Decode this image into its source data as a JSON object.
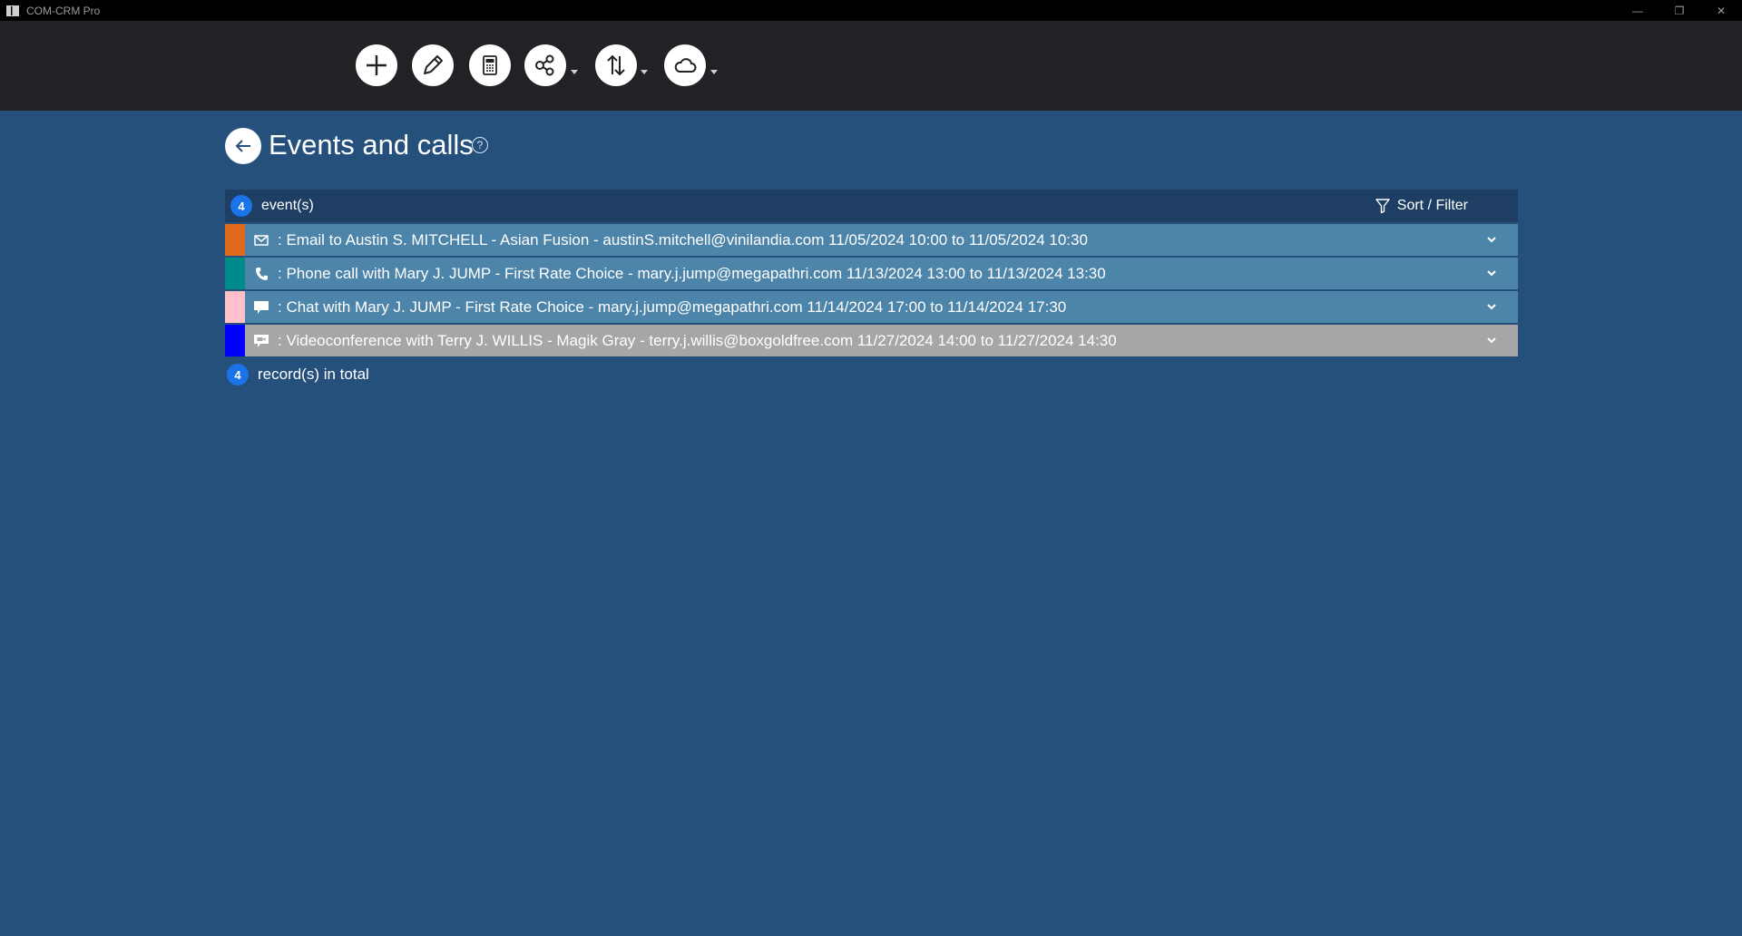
{
  "window": {
    "title": "COM-CRM Pro",
    "controls": {
      "minimize": "—",
      "restore": "❐",
      "close": "✕"
    }
  },
  "toolbar": {
    "buttons": [
      {
        "name": "add-icon"
      },
      {
        "name": "pencil-icon"
      },
      {
        "name": "calculator-icon"
      },
      {
        "name": "share-icon",
        "dropdown": true
      },
      {
        "name": "sort-arrows-icon",
        "dropdown": true
      },
      {
        "name": "cloud-icon",
        "dropdown": true
      }
    ]
  },
  "page": {
    "title": "Events and calls",
    "help_glyph": "?"
  },
  "list": {
    "count": "4",
    "count_label": "event(s)",
    "sort_filter_label": "Sort / Filter",
    "items": [
      {
        "type": "email",
        "icon": "envelope-icon",
        "color": "#e06a1b",
        "text": ": Email to Austin S. MITCHELL - Asian Fusion - austinS.mitchell@vinilandia.com 11/05/2024 10:00 to 11/05/2024 10:30",
        "selected": false
      },
      {
        "type": "phone",
        "icon": "phone-icon",
        "color": "#008b8b",
        "text": ": Phone call with Mary J. JUMP - First Rate Choice - mary.j.jump@megapathri.com 11/13/2024 13:00 to 11/13/2024 13:30",
        "selected": false
      },
      {
        "type": "chat",
        "icon": "chat-icon",
        "color": "#ffc0cb",
        "text": ": Chat with Mary J. JUMP - First Rate Choice - mary.j.jump@megapathri.com 11/14/2024 17:00 to 11/14/2024 17:30",
        "selected": false
      },
      {
        "type": "video",
        "icon": "videoconference-icon",
        "color": "#0000ff",
        "text": ": Videoconference with Terry J. WILLIS - Magik Gray - terry.j.willis@boxgoldfree.com 11/27/2024 14:00 to 11/27/2024 14:30",
        "selected": true
      }
    ]
  },
  "footer": {
    "count": "4",
    "label": "record(s) in total"
  },
  "colors": {
    "background": "#25507c",
    "toolbar": "#202226",
    "row": "#4d84a9",
    "row_selected": "#a6a6a6",
    "badge": "#1a73e8"
  }
}
